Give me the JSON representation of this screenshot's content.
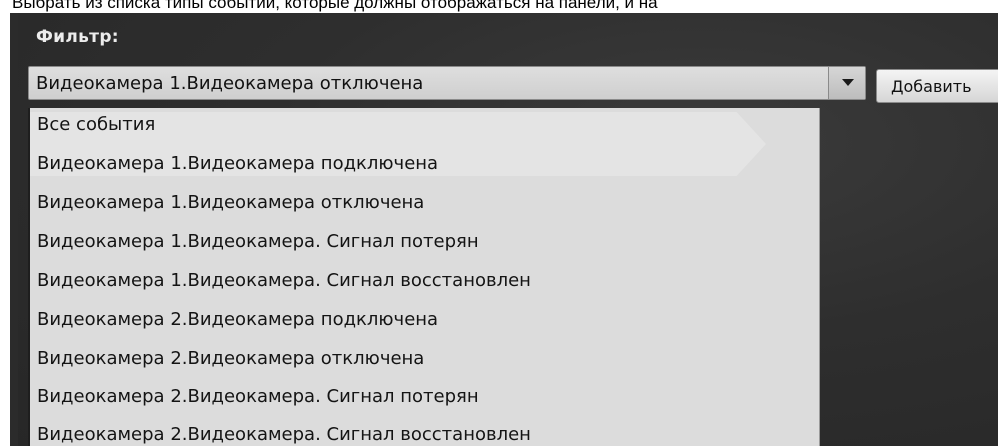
{
  "caption": "Выбрать из списка типы событий, которые должны отображаться на панели, и на",
  "filter": {
    "label": "Фильтр:",
    "selected_value": "Видеокамера 1.Видеокамера отключена",
    "add_button_label": "Добавить"
  },
  "dropdown": {
    "items": [
      "Все события",
      "Видеокамера 1.Видеокамера подключена",
      "Видеокамера 1.Видеокамера отключена",
      "Видеокамера 1.Видеокамера. Сигнал потерян",
      "Видеокамера 1.Видеокамера. Сигнал восстановлен",
      "Видеокамера 2.Видеокамера подключена",
      "Видеокамера 2.Видеокамера отключена",
      "Видеокамера 2.Видеокамера. Сигнал потерян",
      "Видеокамера 2.Видеокамера. Сигнал восстановлен"
    ]
  },
  "icons": {
    "dropdown_toggle": "chevron-down-icon"
  },
  "colors": {
    "panel_background": "#2e2e2e",
    "dropdown_background": "#dcdcdc",
    "label_color": "#ececec"
  }
}
